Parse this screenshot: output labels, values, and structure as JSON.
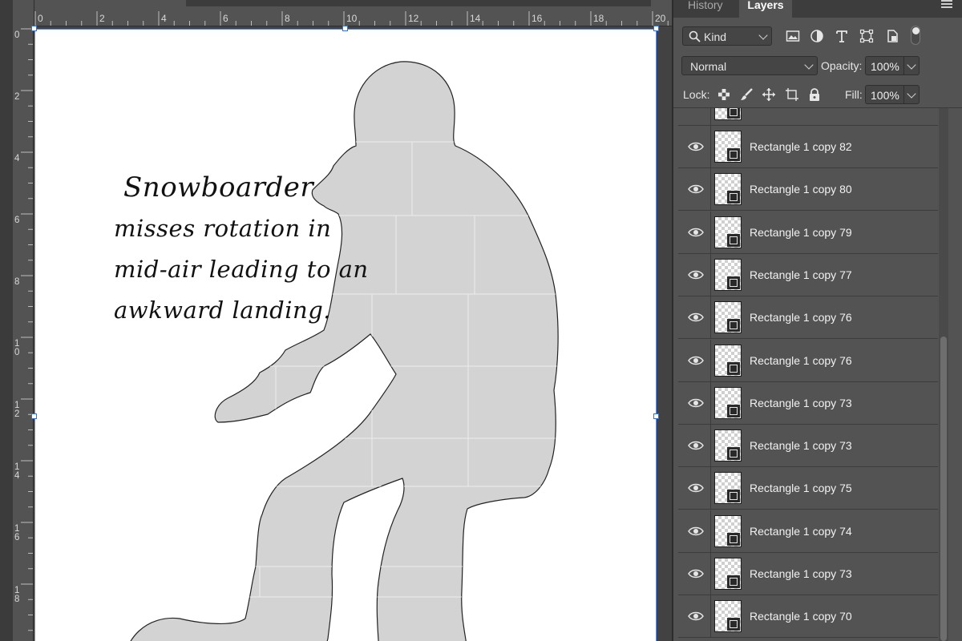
{
  "panel": {
    "tabs": [
      {
        "label": "History"
      },
      {
        "label": "Layers"
      }
    ],
    "filter": {
      "kind_label": "Kind"
    },
    "blend_mode": "Normal",
    "opacity_label": "Opacity:",
    "opacity_value": "100%",
    "lock_label": "Lock:",
    "fill_label": "Fill:",
    "fill_value": "100%"
  },
  "rulers": {
    "top_labels": [
      "0",
      "2",
      "4",
      "6",
      "8",
      "10",
      "12",
      "14",
      "16",
      "18",
      "20"
    ],
    "left_labels": [
      "0",
      "2",
      "4",
      "6",
      "8",
      "10",
      "12",
      "14",
      "16",
      "18"
    ]
  },
  "caption": {
    "line1": "Snowboarder",
    "line2": "misses rotation in",
    "line3": "mid-air leading to an",
    "line4": "awkward landing."
  },
  "layers": [
    {
      "name": "Rectangle 1 copy 82",
      "visible": true
    },
    {
      "name": "Rectangle 1 copy 80",
      "visible": true
    },
    {
      "name": "Rectangle 1 copy 79",
      "visible": true
    },
    {
      "name": "Rectangle 1 copy 77",
      "visible": true
    },
    {
      "name": "Rectangle 1 copy 76",
      "visible": true
    },
    {
      "name": "Rectangle 1 copy 76",
      "visible": true
    },
    {
      "name": "Rectangle 1 copy 73",
      "visible": true
    },
    {
      "name": "Rectangle 1 copy 73",
      "visible": true
    },
    {
      "name": "Rectangle 1 copy 75",
      "visible": true
    },
    {
      "name": "Rectangle 1 copy 74",
      "visible": true
    },
    {
      "name": "Rectangle 1 copy 73",
      "visible": true
    },
    {
      "name": "Rectangle 1 copy 70",
      "visible": true
    }
  ],
  "colors": {
    "panel_bg": "#535353",
    "silhouette_fill": "#d3d3d3",
    "selection_handle": "#2f6fd6"
  }
}
